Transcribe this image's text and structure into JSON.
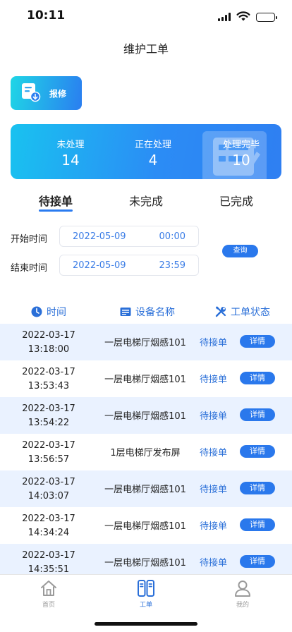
{
  "status_bar": {
    "time": "10:11"
  },
  "nav": {
    "title": "维护工单"
  },
  "repair_button": {
    "label": "报修"
  },
  "stats": [
    {
      "label": "未处理",
      "value": "14"
    },
    {
      "label": "正在处理",
      "value": "4"
    },
    {
      "label": "处理完毕",
      "value": "10"
    }
  ],
  "tabs": [
    {
      "label": "待接单",
      "active": true
    },
    {
      "label": "未完成",
      "active": false
    },
    {
      "label": "已完成",
      "active": false
    }
  ],
  "filter": {
    "start_label": "开始时间",
    "start_date": "2022-05-09",
    "start_time": "00:00",
    "end_label": "结束时间",
    "end_date": "2022-05-09",
    "end_time": "23:59",
    "query_label": "查询"
  },
  "table": {
    "headers": [
      "时间",
      "设备名称",
      "工单状态"
    ],
    "detail_label": "详情",
    "rows": [
      {
        "date": "2022-03-17",
        "time": "13:18:00",
        "device": "一层电梯厅烟感101",
        "status": "待接单"
      },
      {
        "date": "2022-03-17",
        "time": "13:53:43",
        "device": "一层电梯厅烟感101",
        "status": "待接单"
      },
      {
        "date": "2022-03-17",
        "time": "13:54:22",
        "device": "一层电梯厅烟感101",
        "status": "待接单"
      },
      {
        "date": "2022-03-17",
        "time": "13:56:57",
        "device": "1层电梯厅发布屏",
        "status": "待接单"
      },
      {
        "date": "2022-03-17",
        "time": "14:03:07",
        "device": "一层电梯厅烟感101",
        "status": "待接单"
      },
      {
        "date": "2022-03-17",
        "time": "14:34:24",
        "device": "一层电梯厅烟感101",
        "status": "待接单"
      },
      {
        "date": "2022-03-17",
        "time": "14:35:51",
        "device": "一层电梯厅烟感101",
        "status": "待接单"
      }
    ]
  },
  "tabbar": [
    {
      "label": "首页",
      "icon": "home-icon",
      "active": false
    },
    {
      "label": "工单",
      "icon": "work-order-icon",
      "active": true
    },
    {
      "label": "我的",
      "icon": "profile-icon",
      "active": false
    }
  ],
  "colors": {
    "accent": "#2a78ec",
    "row_shade": "#eaf2ff",
    "status_text": "#2a6fd8"
  }
}
